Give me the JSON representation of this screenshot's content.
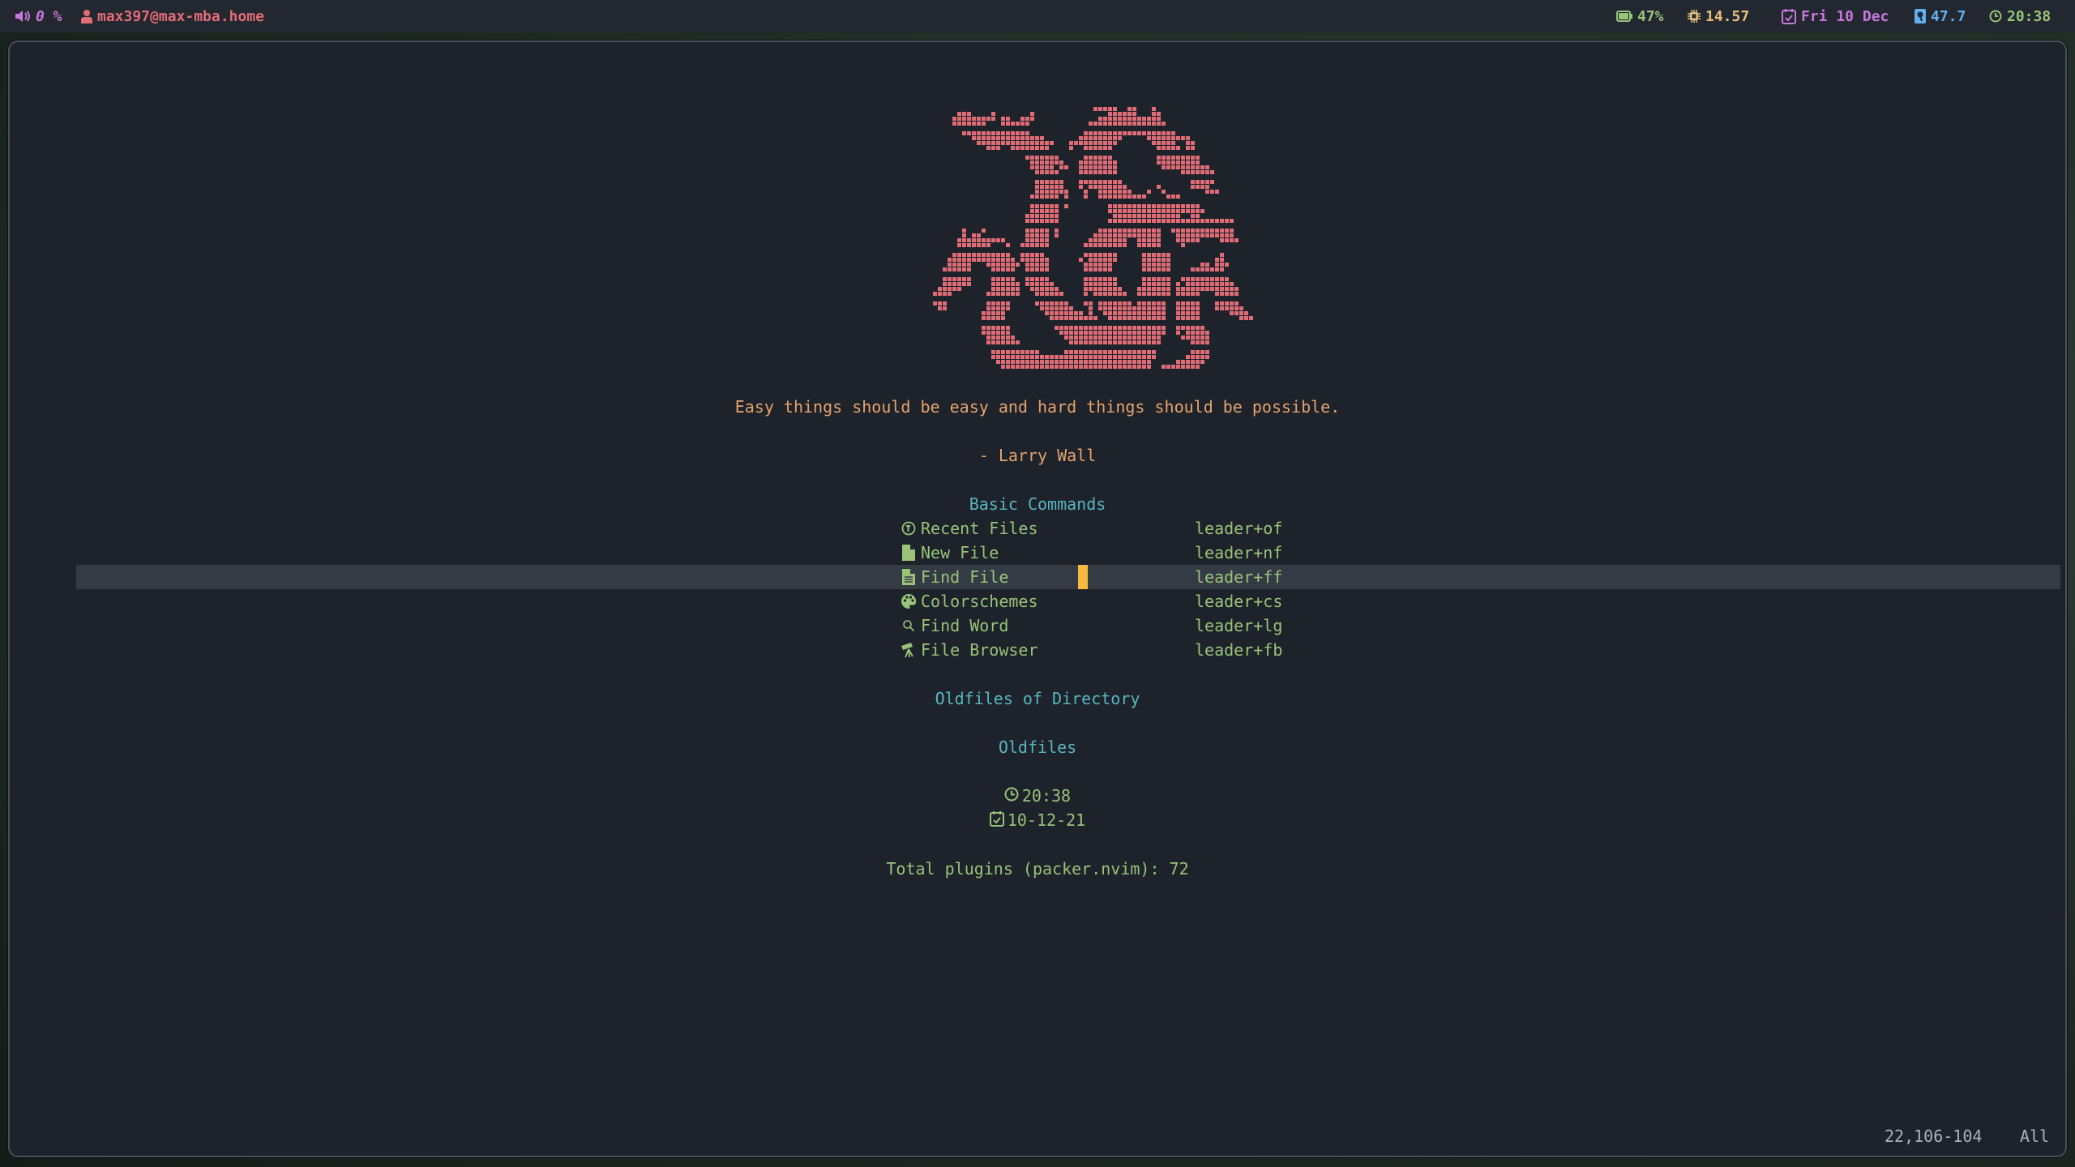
{
  "topbar": {
    "volume": {
      "icon": "volume-icon",
      "value": "0 %",
      "color": "#c678dd"
    },
    "user": {
      "icon": "user-icon",
      "value": "max397@max-mba.home",
      "color": "#e06c75"
    },
    "battery": {
      "icon": "battery-icon",
      "value": "47%",
      "color": "#98c379"
    },
    "cpu": {
      "icon": "cpu-icon",
      "value": "14.57",
      "color": "#e5c07b"
    },
    "date": {
      "icon": "calendar-icon",
      "value": "Fri 10 Dec",
      "color": "#c678dd"
    },
    "disk": {
      "icon": "disk-icon",
      "value": "47.7",
      "color": "#61afef"
    },
    "clock": {
      "icon": "clock-icon",
      "value": "20:38",
      "color": "#98c379"
    }
  },
  "dashboard": {
    "header_art": {
      "color": "#e06c75",
      "dot_rows": [
        [
          [
            33,
            37
          ],
          [
            40,
            41
          ],
          [
            45,
            45
          ]
        ],
        [
          [
            5,
            7
          ],
          [
            12,
            12
          ],
          [
            20,
            20
          ],
          [
            36,
            41
          ],
          [
            45,
            46
          ]
        ],
        [
          [
            4,
            12
          ],
          [
            14,
            15
          ],
          [
            18,
            20
          ],
          [
            34,
            46
          ]
        ],
        [
          [
            4,
            10
          ],
          [
            14,
            19
          ],
          [
            32,
            47
          ]
        ],
        [
          [
            6,
            19
          ],
          [
            31,
            49
          ]
        ],
        [
          [
            8,
            22
          ],
          [
            30,
            38
          ],
          [
            44,
            52
          ]
        ],
        [
          [
            9,
            24
          ],
          [
            28,
            37
          ],
          [
            45,
            49
          ],
          [
            52,
            53
          ]
        ],
        [
          [
            11,
            13
          ],
          [
            16,
            23
          ],
          [
            28,
            28
          ],
          [
            31,
            36
          ],
          [
            46,
            50
          ],
          [
            52,
            53
          ]
        ],
        [
          [
            19,
            25
          ],
          [
            31,
            36
          ],
          [
            46,
            54
          ]
        ],
        [
          [
            20,
            26
          ],
          [
            30,
            37
          ],
          [
            46,
            54
          ]
        ],
        [
          [
            20,
            24
          ],
          [
            26,
            27
          ],
          [
            30,
            37
          ],
          [
            47,
            56
          ]
        ],
        [
          [
            21,
            25
          ],
          [
            30,
            37
          ],
          [
            51,
            57
          ]
        ],
        [
          [
            21,
            26
          ],
          [
            30,
            38
          ],
          [
            53,
            57
          ]
        ],
        [
          [
            21,
            26
          ],
          [
            30,
            30
          ],
          [
            32,
            39
          ],
          [
            46,
            46
          ],
          [
            53,
            56
          ]
        ],
        [
          [
            21,
            27
          ],
          [
            31,
            31
          ],
          [
            34,
            40
          ],
          [
            44,
            44
          ],
          [
            47,
            47
          ],
          [
            56,
            58
          ]
        ],
        [
          [
            20,
            25
          ],
          [
            27,
            27
          ],
          [
            31,
            31
          ],
          [
            34,
            43
          ],
          [
            48,
            50
          ]
        ],
        [
          [
            20,
            25
          ],
          [
            27,
            27
          ],
          [
            36,
            54
          ]
        ],
        [
          [
            20,
            25
          ],
          [
            36,
            55
          ]
        ],
        [
          [
            19,
            25
          ],
          [
            37,
            50
          ],
          [
            53,
            54
          ]
        ],
        [
          [
            19,
            25
          ],
          [
            36,
            61
          ]
        ],
        [
          [
            6,
            6
          ],
          [
            10,
            10
          ],
          [
            19,
            23
          ],
          [
            25,
            25
          ],
          [
            34,
            46
          ],
          [
            49,
            61
          ]
        ],
        [
          [
            6,
            6
          ],
          [
            8,
            9
          ],
          [
            19,
            23
          ],
          [
            25,
            25
          ],
          [
            33,
            46
          ],
          [
            50,
            61
          ]
        ],
        [
          [
            5,
            14
          ],
          [
            19,
            23
          ],
          [
            32,
            39
          ],
          [
            42,
            46
          ],
          [
            50,
            54
          ],
          [
            59,
            62
          ]
        ],
        [
          [
            5,
            11
          ],
          [
            15,
            15
          ],
          [
            18,
            23
          ],
          [
            31,
            39
          ],
          [
            42,
            46
          ],
          [
            51,
            51
          ]
        ],
        [
          [
            4,
            15
          ],
          [
            18,
            22
          ],
          [
            31,
            37
          ],
          [
            43,
            48
          ],
          [
            59,
            59
          ]
        ],
        [
          [
            3,
            16
          ],
          [
            18,
            23
          ],
          [
            30,
            30
          ],
          [
            32,
            37
          ],
          [
            43,
            48
          ],
          [
            58,
            59
          ]
        ],
        [
          [
            3,
            7
          ],
          [
            11,
            17
          ],
          [
            19,
            23
          ],
          [
            31,
            36
          ],
          [
            43,
            48
          ],
          [
            55,
            56
          ],
          [
            58,
            60
          ]
        ],
        [
          [
            2,
            7
          ],
          [
            12,
            16
          ],
          [
            19,
            23
          ],
          [
            31,
            36
          ],
          [
            43,
            48
          ],
          [
            53,
            59
          ]
        ],
        [
          [
            2,
            7
          ],
          [
            12,
            16
          ],
          [
            19,
            23
          ],
          [
            31,
            37
          ],
          [
            43,
            48
          ],
          [
            51,
            60
          ]
        ],
        [
          [
            2,
            7
          ],
          [
            12,
            17
          ],
          [
            19,
            24
          ],
          [
            31,
            37
          ],
          [
            43,
            48
          ],
          [
            50,
            50
          ],
          [
            52,
            61
          ]
        ],
        [
          [
            1,
            5
          ],
          [
            12,
            17
          ],
          [
            20,
            25
          ],
          [
            31,
            38
          ],
          [
            42,
            48
          ],
          [
            50,
            62
          ]
        ],
        [
          [
            0,
            3
          ],
          [
            11,
            17
          ],
          [
            21,
            26
          ],
          [
            31,
            31
          ],
          [
            33,
            39
          ],
          [
            42,
            48
          ],
          [
            50,
            54
          ],
          [
            58,
            62
          ]
        ],
        [
          [
            0,
            2
          ],
          [
            11,
            15
          ],
          [
            21,
            27
          ],
          [
            31,
            32
          ],
          [
            34,
            40
          ],
          [
            42,
            47
          ],
          [
            50,
            54
          ],
          [
            58,
            62
          ]
        ],
        [
          [
            1,
            2
          ],
          [
            11,
            15
          ],
          [
            22,
            28
          ],
          [
            32,
            32
          ],
          [
            34,
            47
          ],
          [
            50,
            54
          ],
          [
            58,
            63
          ]
        ],
        [
          [
            10,
            14
          ],
          [
            23,
            30
          ],
          [
            32,
            32
          ],
          [
            35,
            47
          ],
          [
            50,
            54
          ],
          [
            61,
            64
          ]
        ],
        [
          [
            10,
            14
          ],
          [
            24,
            33
          ],
          [
            36,
            47
          ],
          [
            50,
            54
          ],
          [
            63,
            65
          ]
        ],
        [
          [
            10,
            15
          ],
          [
            25,
            47
          ],
          [
            50,
            55
          ]
        ],
        [
          [
            10,
            15
          ],
          [
            26,
            47
          ],
          [
            50,
            50
          ],
          [
            52,
            56
          ]
        ],
        [
          [
            11,
            16
          ],
          [
            27,
            46
          ],
          [
            51,
            56
          ]
        ],
        [
          [
            11,
            17
          ],
          [
            28,
            46
          ],
          [
            53,
            56
          ]
        ],
        [
          [
            12,
            21
          ],
          [
            27,
            45
          ],
          [
            53,
            56
          ]
        ],
        [
          [
            12,
            45
          ],
          [
            52,
            56
          ]
        ],
        [
          [
            13,
            44
          ],
          [
            50,
            55
          ]
        ],
        [
          [
            14,
            44
          ],
          [
            47,
            54
          ]
        ]
      ]
    },
    "quote": "Easy things should be easy and hard things should be possible.",
    "author": "- Larry Wall",
    "basic_commands_title": "Basic Commands",
    "commands": [
      {
        "icon": "history-icon",
        "label": "Recent Files",
        "shortcut": "leader+of"
      },
      {
        "icon": "new-file-icon",
        "label": "New File",
        "shortcut": "leader+nf"
      },
      {
        "icon": "file-text-icon",
        "label": "Find File",
        "shortcut": "leader+ff"
      },
      {
        "icon": "palette-icon",
        "label": "Colorschemes",
        "shortcut": "leader+cs"
      },
      {
        "icon": "search-icon",
        "label": "Find Word",
        "shortcut": "leader+lg"
      },
      {
        "icon": "telescope-icon",
        "label": "File Browser",
        "shortcut": "leader+fb"
      }
    ],
    "selected_command_index": 2,
    "oldfiles_dir_title": "Oldfiles of Directory",
    "oldfiles_title": "Oldfiles",
    "time": "20:38",
    "date": "10-12-21",
    "plugins": "Total plugins (packer.nvim): 72"
  },
  "statusline": {
    "position": "22,106-104",
    "scroll": "All"
  }
}
